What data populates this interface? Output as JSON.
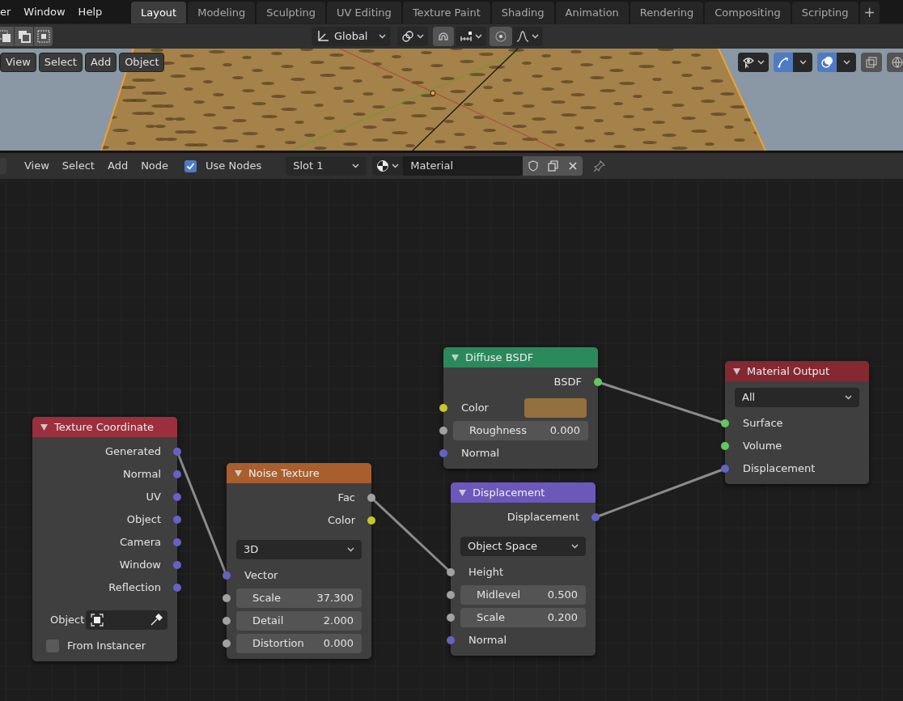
{
  "topbar": {
    "menus": [
      "er",
      "Window",
      "Help"
    ],
    "tabs": [
      {
        "label": "Layout",
        "selected": true
      },
      {
        "label": "Modeling",
        "selected": false
      },
      {
        "label": "Sculpting",
        "selected": false
      },
      {
        "label": "UV Editing",
        "selected": false
      },
      {
        "label": "Texture Paint",
        "selected": false
      },
      {
        "label": "Shading",
        "selected": false
      },
      {
        "label": "Animation",
        "selected": false
      },
      {
        "label": "Rendering",
        "selected": false
      },
      {
        "label": "Compositing",
        "selected": false
      },
      {
        "label": "Scripting",
        "selected": false
      }
    ],
    "add_tab": "+"
  },
  "tool_header": {
    "orientation": "Global"
  },
  "viewport": {
    "menus": [
      "View",
      "Select",
      "Add",
      "Object"
    ]
  },
  "node_header": {
    "menus": [
      "View",
      "Select",
      "Add",
      "Node"
    ],
    "use_nodes": {
      "label": "Use Nodes",
      "checked": true
    },
    "slot": "Slot 1",
    "material": "Material"
  },
  "nodes": [
    {
      "title": "Texture Coordinate",
      "color": "#9b2f3d",
      "rows": [
        {
          "kind": "output",
          "label": "Generated",
          "color": "#6363c7"
        },
        {
          "kind": "output",
          "label": "Normal",
          "color": "#6363c7"
        },
        {
          "kind": "output",
          "label": "UV",
          "color": "#6363c7"
        },
        {
          "kind": "output",
          "label": "Object",
          "color": "#6363c7"
        },
        {
          "kind": "output",
          "label": "Camera",
          "color": "#6363c7"
        },
        {
          "kind": "output",
          "label": "Window",
          "color": "#6363c7"
        },
        {
          "kind": "output",
          "label": "Reflection",
          "color": "#6363c7"
        },
        {
          "kind": "object_field",
          "label": "Object"
        },
        {
          "kind": "checkbox",
          "label": "From Instancer",
          "checked": false
        }
      ]
    },
    {
      "title": "Noise Texture",
      "color": "#a95e2d",
      "rows": [
        {
          "kind": "output",
          "label": "Fac",
          "color": "#a1a1a1"
        },
        {
          "kind": "output",
          "label": "Color",
          "color": "#c7c729"
        },
        {
          "kind": "dropdown",
          "value": "3D"
        },
        {
          "kind": "input",
          "label": "Vector",
          "color": "#6363c7"
        },
        {
          "kind": "field",
          "label": "Scale",
          "value": "37.300",
          "color": "#a1a1a1"
        },
        {
          "kind": "field",
          "label": "Detail",
          "value": "2.000",
          "color": "#a1a1a1"
        },
        {
          "kind": "field",
          "label": "Distortion",
          "value": "0.000",
          "color": "#a1a1a1"
        }
      ]
    },
    {
      "title": "Diffuse BSDF",
      "color": "#2a8a5c",
      "rows": [
        {
          "kind": "output",
          "label": "BSDF",
          "color": "#63c763"
        },
        {
          "kind": "swatch",
          "label": "Color",
          "color": "#c7c729",
          "swatch": {
            "color": "#94703f"
          }
        },
        {
          "kind": "field",
          "label": "Roughness",
          "value": "0.000",
          "color": "#a1a1a1"
        },
        {
          "kind": "input",
          "label": "Normal",
          "color": "#6363c7"
        }
      ]
    },
    {
      "title": "Displacement",
      "color": "#6b58ba",
      "rows": [
        {
          "kind": "output",
          "label": "Displacement",
          "color": "#6363c7"
        },
        {
          "kind": "dropdown",
          "value": "Object Space"
        },
        {
          "kind": "input",
          "label": "Height",
          "color": "#a1a1a1"
        },
        {
          "kind": "field",
          "label": "Midlevel",
          "value": "0.500",
          "color": "#a1a1a1"
        },
        {
          "kind": "field",
          "label": "Scale",
          "value": "0.200",
          "color": "#a1a1a1"
        },
        {
          "kind": "input",
          "label": "Normal",
          "color": "#6363c7"
        }
      ]
    },
    {
      "title": "Material Output",
      "color": "#842832",
      "rows": [
        {
          "kind": "dropdown",
          "value": "All"
        },
        {
          "kind": "input",
          "label": "Surface",
          "color": "#63c763"
        },
        {
          "kind": "input",
          "label": "Volume",
          "color": "#63c763"
        },
        {
          "kind": "input",
          "label": "Displacement",
          "color": "#6363c7"
        }
      ]
    }
  ]
}
